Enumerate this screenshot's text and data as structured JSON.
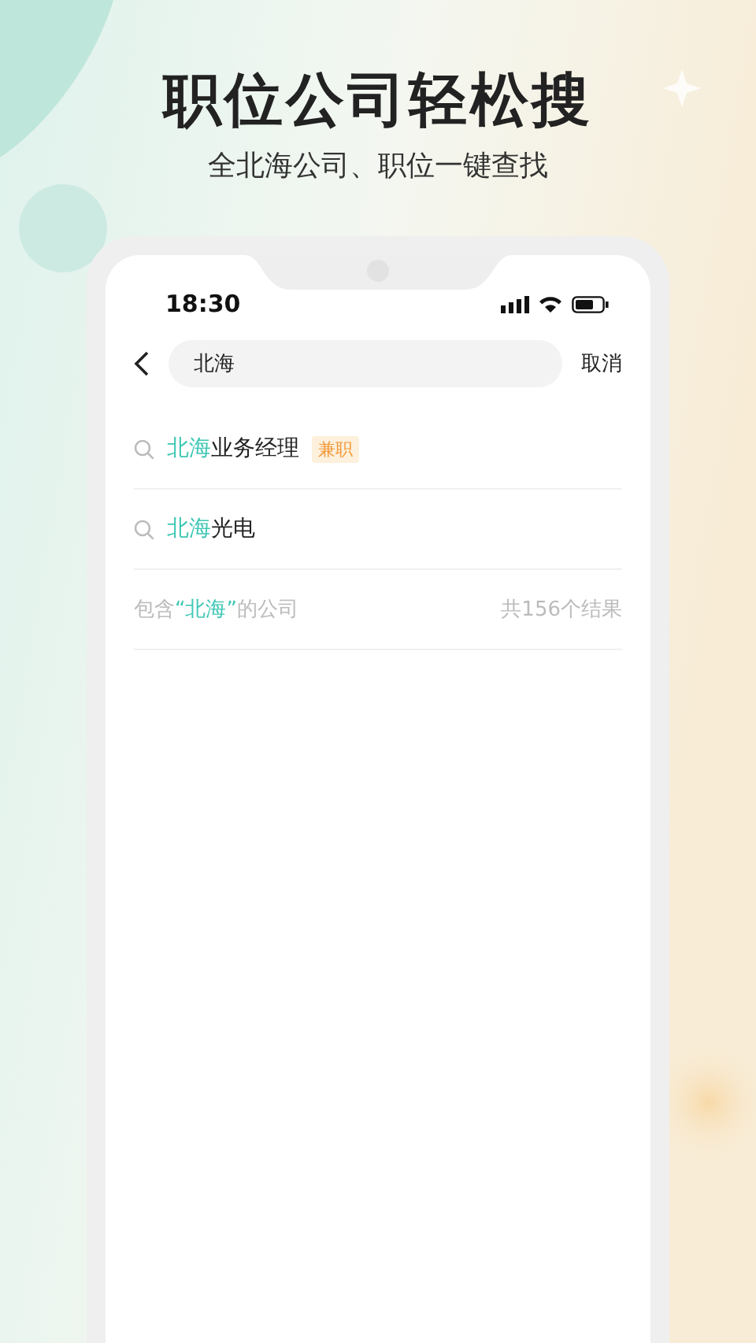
{
  "headline": "职位公司轻松搜",
  "subheadline": "全北海公司、职位一键查找",
  "phone": {
    "status_bar": {
      "time": "18:30"
    },
    "search": {
      "value": "北海",
      "cancel": "取消"
    },
    "suggestions": [
      {
        "match": "北海",
        "rest": "业务经理",
        "tag": "兼职"
      },
      {
        "match": "北海",
        "rest": "光电"
      }
    ],
    "company_result": {
      "prefix": "包含",
      "match": "“北海”",
      "suffix": "的公司",
      "count": "共156个结果"
    }
  }
}
